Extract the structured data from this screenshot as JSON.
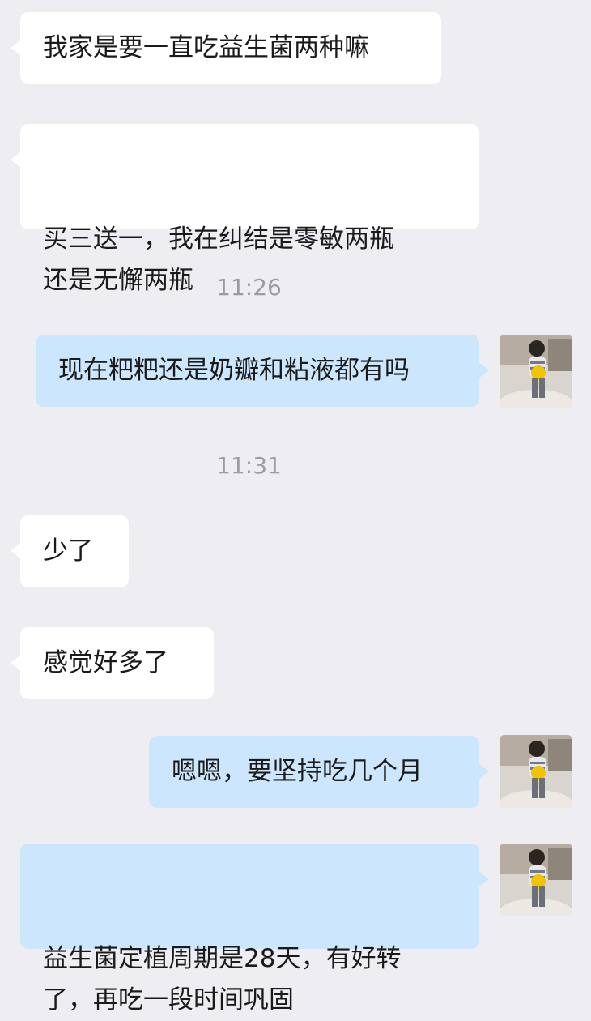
{
  "conversation": {
    "messages": [
      {
        "side": "incoming",
        "text": "我家是要一直吃益生菌两种嘛"
      },
      {
        "side": "incoming",
        "text": "买三送一，我在纠结是零敏两瓶\n还是无懈两瓶"
      },
      {
        "side": "timestamp",
        "text": "11:26"
      },
      {
        "side": "outgoing",
        "text": "现在粑粑还是奶瓣和粘液都有吗"
      },
      {
        "side": "timestamp",
        "text": "11:31"
      },
      {
        "side": "incoming",
        "text": "少了"
      },
      {
        "side": "incoming",
        "text": "感觉好多了"
      },
      {
        "side": "outgoing",
        "text": "嗯嗯，要坚持吃几个月"
      },
      {
        "side": "outgoing",
        "text": "益生菌定植周期是28天，有好转\n了，再吃一段时间巩固"
      }
    ]
  },
  "colors": {
    "background": "#ededf2",
    "incoming_bubble": "#ffffff",
    "outgoing_bubble": "#cce6fd",
    "timestamp_text": "#9b9ba3"
  },
  "icons": {
    "avatar": "child-photo-avatar-icon"
  }
}
